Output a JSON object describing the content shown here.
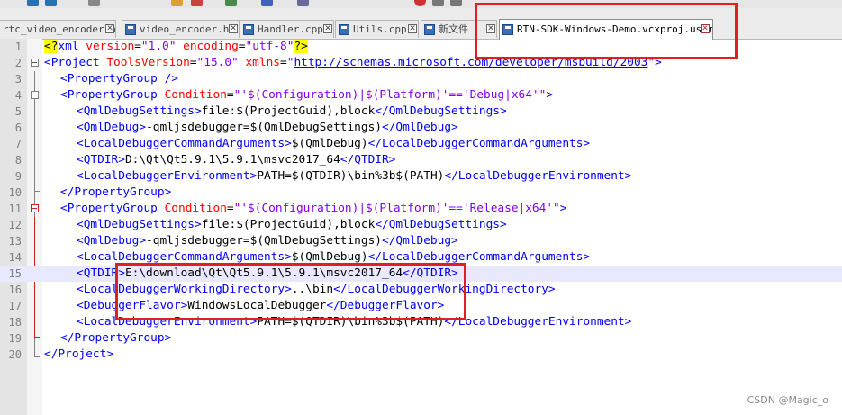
{
  "tabs": [
    {
      "label": "rtc_video_encoder.h",
      "active": false
    },
    {
      "label": "video_encoder.h",
      "active": false
    },
    {
      "label": "Handler.cpp",
      "active": false
    },
    {
      "label": "Utils.cpp",
      "active": false
    },
    {
      "label": "新文件",
      "active": false
    },
    {
      "label": "RTN-SDK-Windows-Demo.vcxproj.user",
      "active": true
    }
  ],
  "editor": {
    "lines": [
      {
        "n": "1"
      },
      {
        "n": "2"
      },
      {
        "n": "3"
      },
      {
        "n": "4"
      },
      {
        "n": "5"
      },
      {
        "n": "6"
      },
      {
        "n": "7"
      },
      {
        "n": "8"
      },
      {
        "n": "9"
      },
      {
        "n": "10"
      },
      {
        "n": "11"
      },
      {
        "n": "12"
      },
      {
        "n": "13"
      },
      {
        "n": "14"
      },
      {
        "n": "15"
      },
      {
        "n": "16"
      },
      {
        "n": "17"
      },
      {
        "n": "18"
      },
      {
        "n": "19"
      },
      {
        "n": "20"
      }
    ],
    "text": {
      "l1": {
        "a": "<?",
        "b": "xml",
        "c": " version",
        "d": "=",
        "e": "\"1.0\"",
        "f": " encoding",
        "g": "=",
        "h": "\"utf-8\"",
        "i": "?>"
      },
      "l2": {
        "a": "<Project",
        "b": " ToolsVersion",
        "c": "=",
        "d": "\"15.0\"",
        "e": " xmlns",
        "f": "=",
        "g": "\"",
        "h": "http://schemas.microsoft.com/developer/msbuild/2003",
        "i": "\"",
        "j": ">"
      },
      "l3": {
        "a": "<PropertyGroup />"
      },
      "l4": {
        "a": "<PropertyGroup",
        "b": " Condition",
        "c": "=",
        "d": "\"'$(Configuration)|$(Platform)'=='Debug|x64'\"",
        "e": ">"
      },
      "l5": {
        "a": "<QmlDebugSettings>",
        "b": "file:$(ProjectGuid),block",
        "c": "</QmlDebugSettings>"
      },
      "l6": {
        "a": "<QmlDebug>",
        "b": "-qmljsdebugger=$(QmlDebugSettings)",
        "c": "</QmlDebug>"
      },
      "l7": {
        "a": "<LocalDebuggerCommandArguments>",
        "b": "$(QmlDebug)",
        "c": "</LocalDebuggerCommandArguments>"
      },
      "l8": {
        "a": "<QTDIR>",
        "b": "D:\\Qt\\Qt5.9.1\\5.9.1\\msvc2017_64",
        "c": "</QTDIR>"
      },
      "l9": {
        "a": "<LocalDebuggerEnvironment>",
        "b": "PATH=$(QTDIR)\\bin%3b$(PATH)",
        "c": "</LocalDebuggerEnvironment>"
      },
      "l10": {
        "a": "</PropertyGroup>"
      },
      "l11": {
        "a": "<PropertyGroup",
        "b": " Condition",
        "c": "=",
        "d": "\"'$(Configuration)|$(Platform)'=='Release|x64'\"",
        "e": ">"
      },
      "l12": {
        "a": "<QmlDebugSettings>",
        "b": "file:$(ProjectGuid),block",
        "c": "</QmlDebugSettings>"
      },
      "l13": {
        "a": "<QmlDebug>",
        "b": "-qmljsdebugger=$(QmlDebugSettings)",
        "c": "</QmlDebug>"
      },
      "l14": {
        "a": "<LocalDebuggerCommandArguments>",
        "b": "$(QmlDebug)",
        "c": "</LocalDebuggerCommandArguments>"
      },
      "l15": {
        "a": "<QTDIR>",
        "b": "E:\\download\\Qt\\Qt5.9.1\\5.9.1\\msvc2017_64",
        "c": "</QTDIR>"
      },
      "l16": {
        "a": "<LocalDebuggerWorkingDirectory>",
        "b": "..\\bin",
        "c": "</LocalDebuggerWorkingDirectory>"
      },
      "l17": {
        "a": "<DebuggerFlavor>",
        "b": "WindowsLocalDebugger",
        "c": "</DebuggerFlavor>"
      },
      "l18": {
        "a": "<LocalDebuggerEnvironment>",
        "b": "PATH=$(QTDIR)\\bin%3b$(PATH)",
        "c": "</LocalDebuggerEnvironment>"
      },
      "l19": {
        "a": "</PropertyGroup>"
      },
      "l20": {
        "a": "</Project>"
      }
    }
  },
  "watermark": "CSDN @Magic_o",
  "colors": {
    "tag": "#0000ff",
    "attribute": "#ff0000",
    "value": "#8000ff",
    "highlight": "#ff0000"
  }
}
